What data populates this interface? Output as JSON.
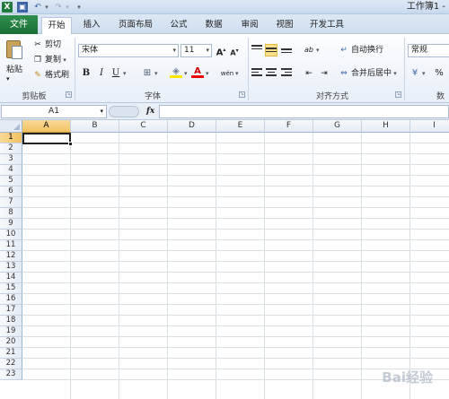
{
  "window": {
    "title": "工作簿1 -"
  },
  "app_icon": {
    "glyph": "X"
  },
  "quick_access": {
    "save_glyph": "▣",
    "undo_glyph": "↶",
    "redo_glyph": "↷",
    "dropdown_glyph": "▾",
    "customize_glyph": "▾"
  },
  "tabs": [
    {
      "label": "文件"
    },
    {
      "label": "开始"
    },
    {
      "label": "插入"
    },
    {
      "label": "页面布局"
    },
    {
      "label": "公式"
    },
    {
      "label": "数据"
    },
    {
      "label": "审阅"
    },
    {
      "label": "视图"
    },
    {
      "label": "开发工具"
    }
  ],
  "clipboard": {
    "paste_label": "粘贴",
    "cut_label": "剪切",
    "copy_label": "复制",
    "format_painter_label": "格式刷",
    "group_label": "剪贴板"
  },
  "font": {
    "name": "宋体",
    "size": "11",
    "grow": "A",
    "shrink": "A",
    "bold": "B",
    "italic": "I",
    "underline": "U",
    "border_glyph": "⊞",
    "fill_glyph": "◈",
    "color_glyph": "A",
    "phonetic_glyph": "wén",
    "group_label": "字体"
  },
  "alignment": {
    "wrap_label": "自动换行",
    "merge_label": "合并后居中",
    "orientation_glyph": "ab",
    "group_label": "对齐方式"
  },
  "number": {
    "format": "常规",
    "percent": "%",
    "group_label": "数"
  },
  "formula_bar": {
    "name_box": "A1",
    "fx": "fx",
    "value": ""
  },
  "columns": [
    "A",
    "B",
    "C",
    "D",
    "E",
    "F",
    "G",
    "H",
    "I"
  ],
  "rows": [
    "1",
    "2",
    "3",
    "4",
    "5",
    "6",
    "7",
    "8",
    "9",
    "10",
    "11",
    "12",
    "13",
    "14",
    "15",
    "16",
    "17",
    "18",
    "19",
    "20",
    "21",
    "22",
    "23"
  ],
  "active_cell": "A1",
  "watermark": "Bai经验"
}
